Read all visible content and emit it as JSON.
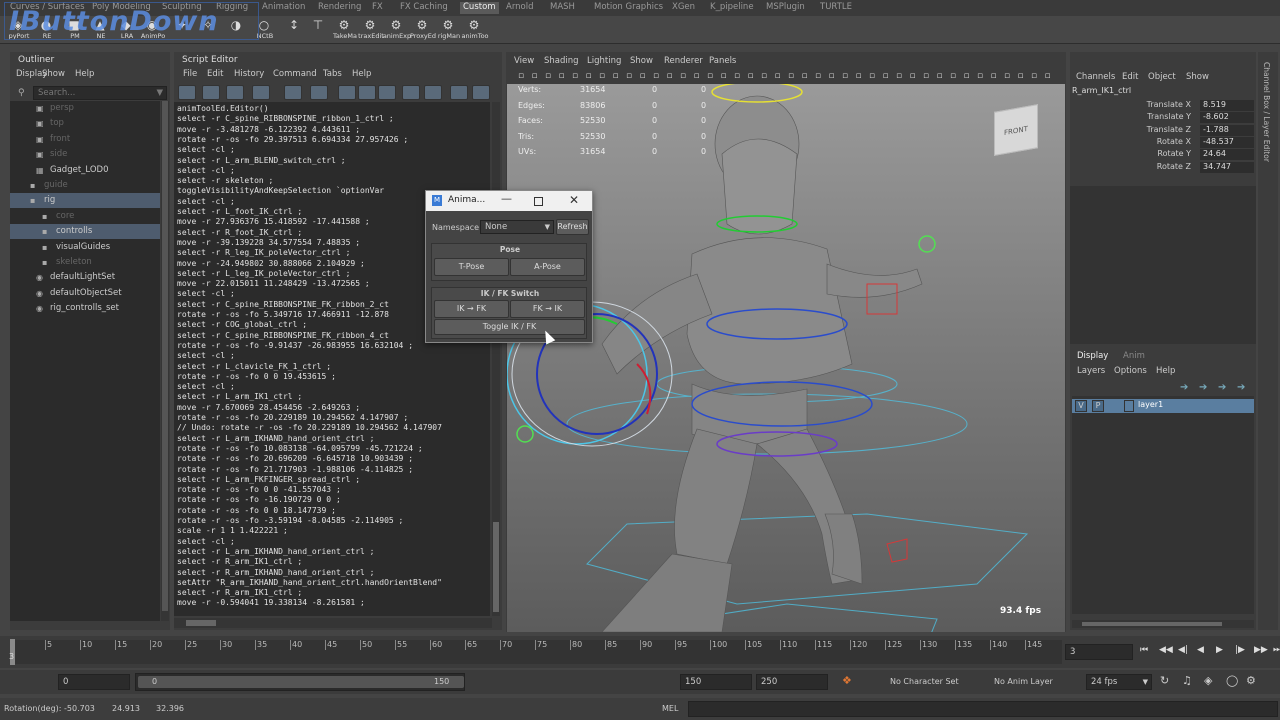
{
  "watermark": "IButtonDown",
  "shelf_tabs": [
    "Curves / Surfaces",
    "Poly Modeling",
    "Sculpting",
    "Rigging",
    "Animation",
    "Rendering",
    "FX",
    "FX Caching",
    "Custom",
    "Arnold",
    "MASH",
    "Motion Graphics",
    "XGen",
    "K_pipeline",
    "MSPlugin",
    "TURTLE"
  ],
  "shelf_active_tab": "Custom",
  "shelf_items": [
    "pyPort",
    "RE",
    "PM",
    "NE",
    "LRA",
    "AnimPo",
    "",
    "",
    "",
    "NCtB",
    "",
    "",
    "TakeMa",
    "traxEdit",
    "animExp",
    "ProxyEd",
    "rigMan",
    "animToo"
  ],
  "outliner": {
    "title": "Outliner",
    "menu": [
      "Display",
      "Show",
      "Help"
    ],
    "search_placeholder": "Search...",
    "items": [
      {
        "label": "persp",
        "dim": true
      },
      {
        "label": "top",
        "dim": true
      },
      {
        "label": "front",
        "dim": true
      },
      {
        "label": "side",
        "dim": true
      },
      {
        "label": "Gadget_LOD0",
        "dim": false
      },
      {
        "label": "guide",
        "dim": true
      },
      {
        "label": "rig",
        "dim": false
      },
      {
        "label": "core",
        "dim": true
      },
      {
        "label": "controlls",
        "dim": false
      },
      {
        "label": "visualGuides",
        "dim": false
      },
      {
        "label": "skeleton",
        "dim": true
      },
      {
        "label": "defaultLightSet",
        "dim": false
      },
      {
        "label": "defaultObjectSet",
        "dim": false
      },
      {
        "label": "rig_controlls_set",
        "dim": false
      }
    ]
  },
  "script_editor": {
    "title": "Script Editor",
    "menu": [
      "File",
      "Edit",
      "History",
      "Command",
      "Tabs",
      "Help"
    ],
    "lines": [
      "animToolEd.Editor()",
      "select -r C_spine_RIBBONSPINE_ribbon_1_ctrl ;",
      "move -r -3.481278 -6.122392 4.443611 ;",
      "rotate -r -os -fo 29.397513 6.694334 27.957426 ;",
      "select -cl ;",
      "select -r L_arm_BLEND_switch_ctrl ;",
      "select -cl ;",
      "select -r skeleton ;",
      "toggleVisibilityAndKeepSelection `optionVar",
      "select -cl ;",
      "select -r L_foot_IK_ctrl ;",
      "move -r 27.936376 15.418592 -17.441588 ;",
      "select -r R_foot_IK_ctrl ;",
      "move -r -39.139228 34.577554 7.48835 ;",
      "select -r R_leg_IK_poleVector_ctrl ;",
      "move -r -24.949802 30.888066 2.104929 ;",
      "select -r L_leg_IK_poleVector_ctrl ;",
      "move -r 22.015011 11.248429 -13.472565 ;",
      "select -cl ;",
      "select -r C_spine_RIBBONSPINE_FK_ribbon_2_ct",
      "rotate -r -os -fo 5.349716 17.466911 -12.878",
      "select -r COG_global_ctrl ;",
      "select -r C_spine_RIBBONSPINE_FK_ribbon_4_ct",
      "rotate -r -os -fo -9.91437 -26.983955 16.632104 ;",
      "select -cl ;",
      "select -r L_clavicle_FK_1_ctrl ;",
      "rotate -r -os -fo 0 0 19.453615 ;",
      "select -cl ;",
      "select -r L_arm_IK1_ctrl ;",
      "move -r 7.670069 28.454456 -2.649263 ;",
      "rotate -r -os -fo 20.229189 10.294562 4.147907 ;",
      "// Undo: rotate -r -os -fo 20.229189 10.294562 4.147907",
      "select -r L_arm_IKHAND_hand_orient_ctrl ;",
      "rotate -r -os -fo 10.083138 -64.095799 -45.721224 ;",
      "rotate -r -os -fo 20.696209 -6.645718 10.903439 ;",
      "rotate -r -os -fo 21.717903 -1.988106 -4.114825 ;",
      "select -r L_arm_FKFINGER_spread_ctrl ;",
      "rotate -r -os -fo 0 0 -41.557043 ;",
      "rotate -r -os -fo -16.190729 0 0 ;",
      "rotate -r -os -fo 0 0 18.147739 ;",
      "rotate -r -os -fo -3.59194 -8.04585 -2.114905 ;",
      "scale -r 1 1 1.422221 ;",
      "select -cl ;",
      "select -r L_arm_IKHAND_hand_orient_ctrl ;",
      "select -r R_arm_IK1_ctrl ;",
      "select -r R_arm_IKHAND_hand_orient_ctrl ;",
      "setAttr \"R_arm_IKHAND_hand_orient_ctrl.handOrientBlend\"",
      "select -r R_arm_IK1_ctrl ;",
      "move -r -0.594041 19.338134 -8.261581 ;"
    ]
  },
  "viewport": {
    "menu": [
      "View",
      "Shading",
      "Lighting",
      "Show",
      "Renderer",
      "Panels"
    ],
    "hud": [
      {
        "label": "Verts:",
        "v1": "31654",
        "v2": "0",
        "v3": "0"
      },
      {
        "label": "Edges:",
        "v1": "83806",
        "v2": "0",
        "v3": "0"
      },
      {
        "label": "Faces:",
        "v1": "52530",
        "v2": "0",
        "v3": "0"
      },
      {
        "label": "Tris:",
        "v1": "52530",
        "v2": "0",
        "v3": "0"
      },
      {
        "label": "UVs:",
        "v1": "31654",
        "v2": "0",
        "v3": "0"
      }
    ],
    "view_cube": "FRONT",
    "fps": "93.4 fps"
  },
  "anim_dialog": {
    "title": "Anima...",
    "namespace_label": "Namespace:",
    "namespace_value": "None",
    "refresh": "Refresh",
    "pose_header": "Pose",
    "tpose": "T-Pose",
    "apose": "A-Pose",
    "ikfk_header": "IK / FK Switch",
    "ik_to_fk": "IK → FK",
    "fk_to_ik": "FK → IK",
    "toggle": "Toggle IK / FK"
  },
  "channel_box": {
    "menu": [
      "Channels",
      "Edit",
      "Object",
      "Show"
    ],
    "side_tab": "Channel Box / Layer Editor",
    "object": "R_arm_IK1_ctrl",
    "channels": [
      {
        "label": "Translate X",
        "value": "8.519"
      },
      {
        "label": "Translate Y",
        "value": "-8.602"
      },
      {
        "label": "Translate Z",
        "value": "-1.788"
      },
      {
        "label": "Rotate X",
        "value": "-48.537"
      },
      {
        "label": "Rotate Y",
        "value": "24.64"
      },
      {
        "label": "Rotate Z",
        "value": "34.747"
      }
    ]
  },
  "layer_editor": {
    "tabs": [
      "Display",
      "Anim"
    ],
    "menu": [
      "Layers",
      "Options",
      "Help"
    ],
    "layer": {
      "v": "V",
      "p": "P",
      "name": "layer1"
    }
  },
  "timeline": {
    "ticks": [
      "5",
      "10",
      "15",
      "20",
      "25",
      "30",
      "35",
      "40",
      "45",
      "50",
      "55",
      "60",
      "65",
      "70",
      "75",
      "80",
      "85",
      "90",
      "95",
      "100",
      "105",
      "110",
      "115",
      "120",
      "125",
      "130",
      "135",
      "140",
      "145"
    ],
    "current_frame_label": "3",
    "current_frame": "3"
  },
  "range": {
    "start": "0",
    "inner_start": "0",
    "inner_end": "150",
    "end_a": "150",
    "end_b": "250",
    "character_set": "No Character Set",
    "anim_layer": "No Anim Layer",
    "fps": "24 fps"
  },
  "status": {
    "label": "Rotation(deg):",
    "x": "-50.703",
    "y": "24.913",
    "z": "32.396",
    "mel": "MEL"
  }
}
